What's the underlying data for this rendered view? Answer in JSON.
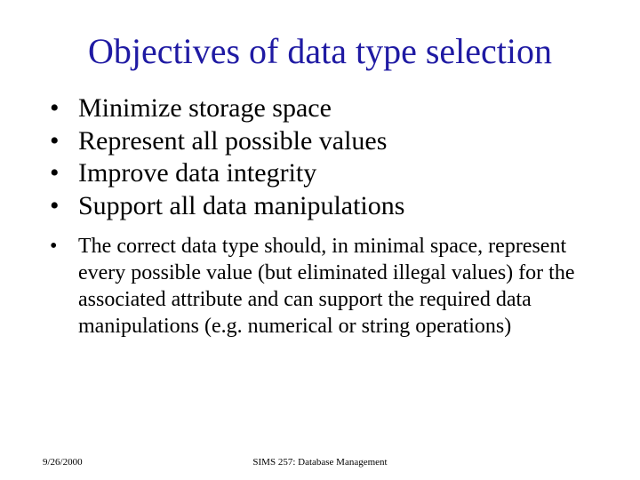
{
  "title": "Objectives of data type selection",
  "bullets": {
    "main": [
      "Minimize storage space",
      "Represent all possible values",
      "Improve data integrity",
      "Support all data manipulations"
    ],
    "sub": [
      "The correct data type should, in minimal space, represent every possible value (but eliminated illegal values) for the associated attribute and can support the required data manipulations (e.g. numerical or string operations)"
    ]
  },
  "footer": {
    "date": "9/26/2000",
    "course": "SIMS 257: Database Management"
  }
}
